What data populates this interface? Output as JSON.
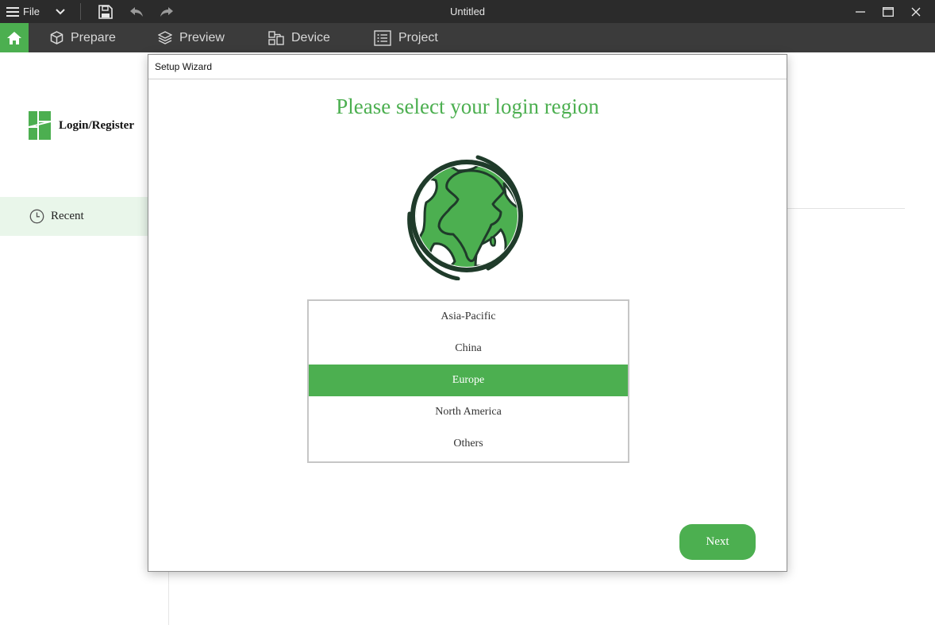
{
  "titlebar": {
    "file_label": "File",
    "window_title": "Untitled"
  },
  "nav": {
    "items": [
      {
        "label": "Prepare",
        "icon": "cube-icon"
      },
      {
        "label": "Preview",
        "icon": "layers-icon"
      },
      {
        "label": "Device",
        "icon": "device-icon"
      },
      {
        "label": "Project",
        "icon": "list-icon"
      }
    ]
  },
  "sidebar": {
    "login_label": "Login/Register",
    "recent_label": "Recent"
  },
  "dialog": {
    "title": "Setup Wizard",
    "heading": "Please select your login region",
    "regions": [
      "Asia-Pacific",
      "China",
      "Europe",
      "North America",
      "Others"
    ],
    "selected_region": "Europe",
    "next_label": "Next"
  },
  "colors": {
    "accent": "#4caf50",
    "titlebar": "#2b2b2b",
    "navbar": "#3b3b3b",
    "globe_dark": "#1f3b2a"
  }
}
